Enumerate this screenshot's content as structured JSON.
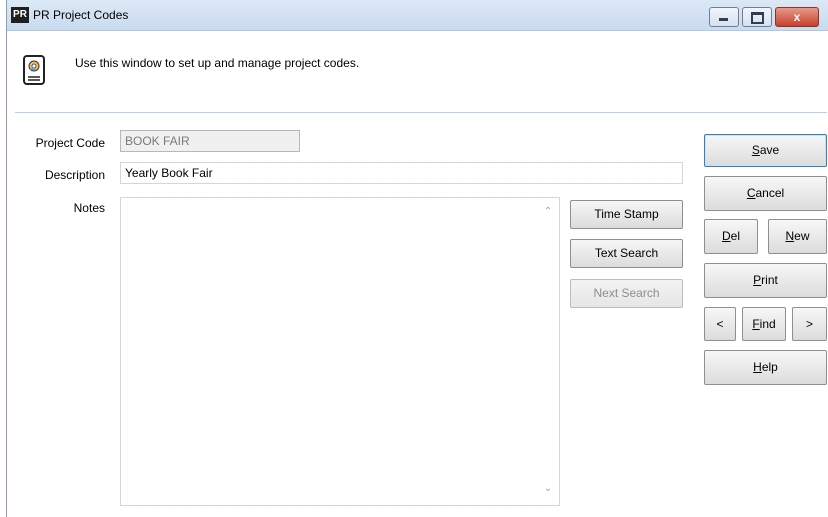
{
  "window": {
    "app_icon_text": "PR",
    "title": "PR Project Codes",
    "controls": {
      "minimize": "minimize",
      "maximize": "maximize",
      "close": "x"
    }
  },
  "header": {
    "icon": "document-gear-icon",
    "info_text": "Use this window to set up and manage project codes."
  },
  "form": {
    "project_code": {
      "label": "Project Code",
      "value": "BOOK FAIR"
    },
    "description": {
      "label": "Description",
      "value": "Yearly Book Fair"
    },
    "notes": {
      "label": "Notes",
      "value": ""
    }
  },
  "notes_buttons": {
    "time_stamp": "Time Stamp",
    "text_search": "Text Search",
    "next_search": "Next Search"
  },
  "actions": {
    "save": {
      "pre": "",
      "key": "S",
      "post": "ave"
    },
    "cancel": {
      "pre": "",
      "key": "C",
      "post": "ancel"
    },
    "del": {
      "pre": "",
      "key": "D",
      "post": "el"
    },
    "new": {
      "pre": "",
      "key": "N",
      "post": "ew"
    },
    "print": {
      "pre": "",
      "key": "P",
      "post": "rint"
    },
    "prev": "<",
    "find": {
      "pre": "",
      "key": "F",
      "post": "ind"
    },
    "next": ">",
    "help": {
      "pre": "",
      "key": "H",
      "post": "elp"
    }
  }
}
